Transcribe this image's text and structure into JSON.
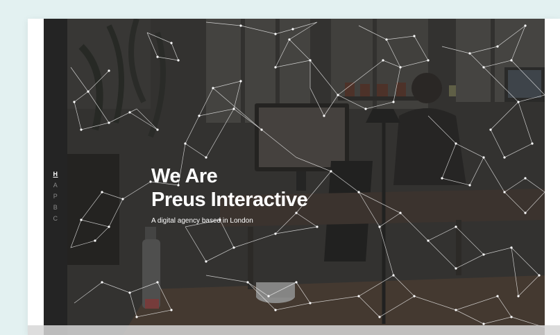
{
  "hero": {
    "line1": "We Are",
    "line2": "Preus Interactive",
    "subtitle": "A digital agency based in London"
  },
  "nav": {
    "items": [
      "H",
      "A",
      "P",
      "B",
      "C"
    ],
    "active_index": 0
  },
  "colors": {
    "page_background": "#e3f1f1",
    "sidebar": "#242424",
    "hero_overlay": "#2b2a29",
    "text": "#ffffff",
    "network_lines": "#ffffff"
  },
  "background": {
    "image": "dimmed office photo with desks, monitors, plants and a person working",
    "overlay": "white particle network of connected lines and dots"
  }
}
